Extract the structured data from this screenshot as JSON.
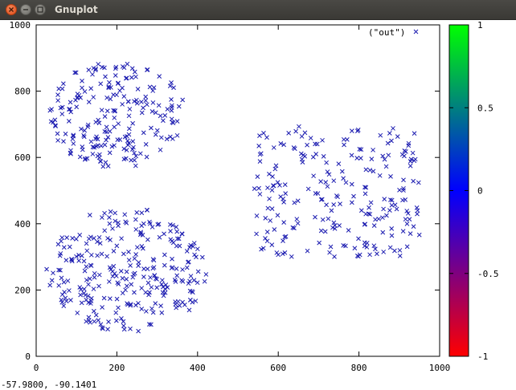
{
  "window": {
    "title": "Gnuplot",
    "buttons": [
      "close",
      "minimize",
      "maximize"
    ]
  },
  "status_bar": {
    "coordinates": "-57.9800, -90.1401"
  },
  "colors": {
    "point": "#1b1bb0",
    "colorbar_top": "#00ff00",
    "colorbar_mid": "#0000ff",
    "colorbar_bottom": "#ff0000"
  },
  "chart_data": {
    "type": "scatter",
    "legend": "(\"out\")",
    "legend_position": "top-right",
    "point_symbol": "x",
    "xlim": [
      0,
      1000
    ],
    "ylim": [
      0,
      1000
    ],
    "xticks": [
      "0",
      "200",
      "400",
      "600",
      "800",
      "1000"
    ],
    "yticks": [
      "0",
      "200",
      "400",
      "600",
      "800",
      "1000"
    ],
    "grid": false,
    "colorbar": {
      "range": [
        -1,
        1
      ],
      "ticks": [
        "1",
        "0.5",
        "0",
        "-0.5",
        "-1"
      ],
      "gradient": [
        "#00ff00",
        "#0000ff",
        "#ff0000"
      ]
    },
    "clusters": [
      {
        "name": "top-left blob",
        "center": [
          200,
          730
        ],
        "radius": 170,
        "approx_points": 210
      },
      {
        "name": "bottom-left blob",
        "center": [
          225,
          260
        ],
        "radius": 200,
        "approx_points": 280
      },
      {
        "name": "right rectangle",
        "x_range": [
          540,
          950
        ],
        "y_range": [
          300,
          695
        ],
        "approx_points": 230
      }
    ]
  }
}
